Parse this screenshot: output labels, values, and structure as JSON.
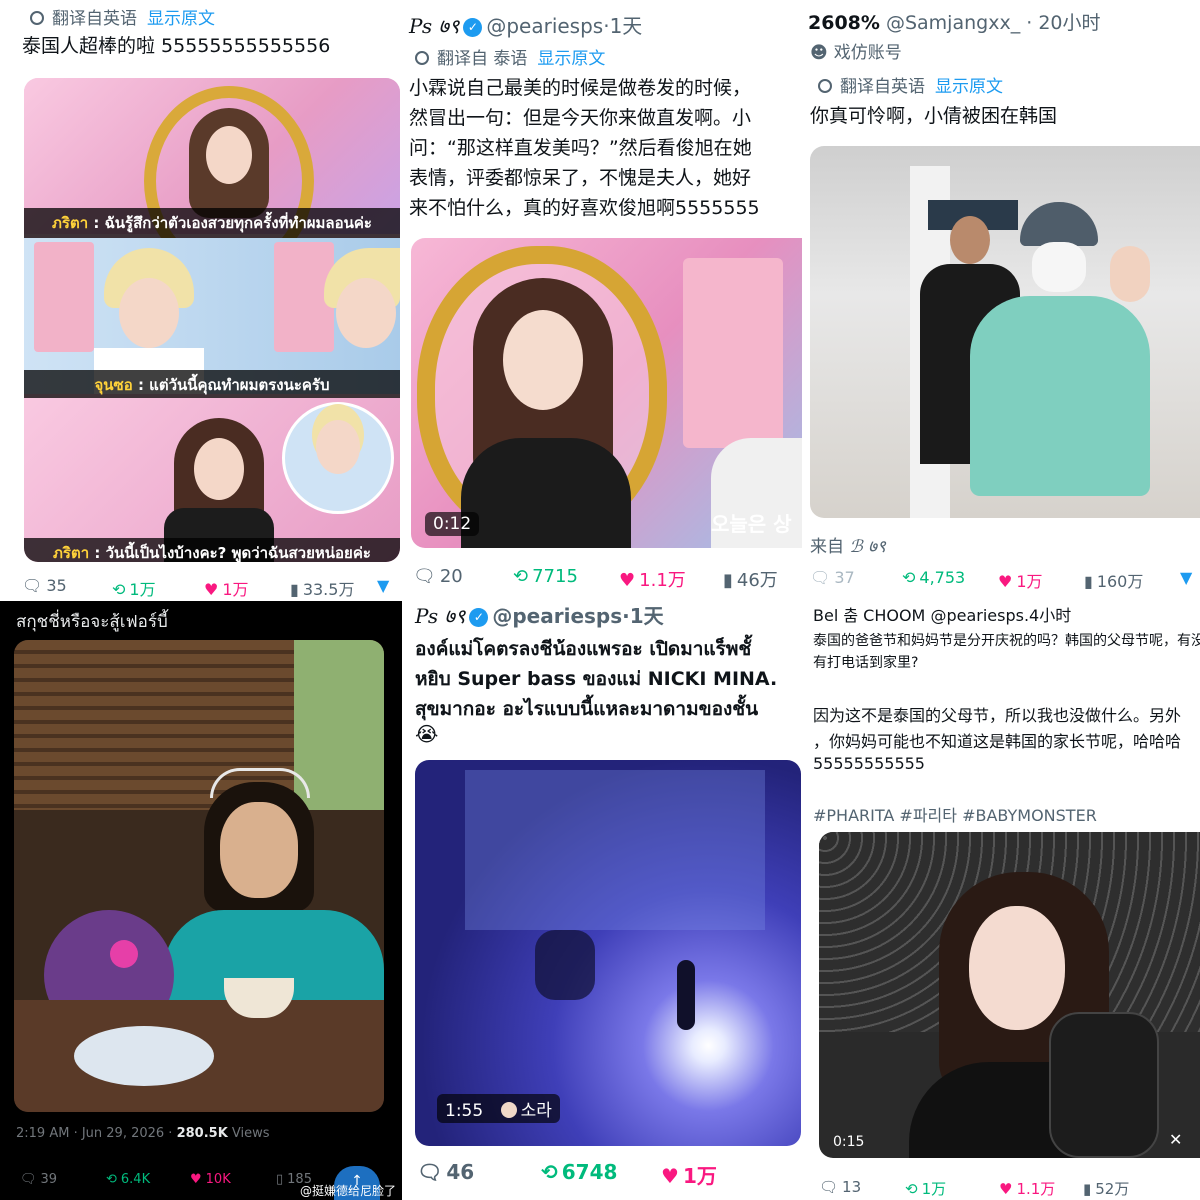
{
  "colors": {
    "accent": "#1d9bf0",
    "retweet": "#00ba7c",
    "like": "#f91880",
    "muted": "#536471"
  },
  "p1": {
    "translated_from": "翻译自英语",
    "show_original": "显示原文",
    "text": "泰国人超棒的啦 55555555555556",
    "sub1_name": "ภริตา",
    "sub1": " : ฉันรู้สึกว่าตัวเองสวยทุกครั้งที่ทำผมลอนค่ะ",
    "sub2_name": "จุนซอ",
    "sub2": " : แต่วันนี้คุณทำผมตรงนะครับ",
    "sub3_name": "ภริตา",
    "sub3": " : วันนี้เป็นไงบ้างคะ? พูดว่าฉันสวยหน่อยค่ะ",
    "replies": "35",
    "retweets": "1万",
    "likes": "1万",
    "views": "33.5万"
  },
  "p2": {
    "name": "Ps ७९",
    "handle": "@peariesps",
    "time": "·1天",
    "translated_from": "翻译自 泰语",
    "show_original": "显示原文",
    "text_lines": [
      "小霖说自己最美的时候是做卷发的时候，",
      "然冒出一句：但是今天你来做直发啊。小",
      "问：“那这样直发美吗？”然后看俊旭在她",
      "表情，评委都惊呆了，不愧是夫人，她好",
      "来不怕什么，真的好喜欢俊旭啊5555555"
    ],
    "duration": "0:12",
    "korean_caption": "오늘은 상",
    "replies": "20",
    "retweets": "7715",
    "likes": "1.1万",
    "views": "46万"
  },
  "p3": {
    "name": "2608%",
    "handle": "@Samjangxx_",
    "time": "· 20小时",
    "parody": "戏仿账号",
    "translated_from": "翻译自英语",
    "show_original": "显示原文",
    "text": "你真可怜啊，小倩被困在韩国",
    "from_label": "来自",
    "from_name": "ℬ ७९",
    "replies": "37",
    "retweets": "4,753",
    "likes": "1万",
    "views": "160万"
  },
  "p4": {
    "text": "สกุชชี่หรือจะสู้เฟอร์บี้",
    "timestamp": "2:19 AM · Jun 29, 2026 · ",
    "views_num": "280.5K",
    "views_label": " Views",
    "replies": "39",
    "retweets": "6.4K",
    "likes": "10K",
    "bookmarks": "185",
    "watermark": "@挺嫌德给尼脸了"
  },
  "p5": {
    "name": "Ps ७९",
    "handle": "@peariesps",
    "time": "·1天",
    "text_lines": [
      "องค์แม่โคตรลงชีน้องแพรอะ เปิดมาแร็พชั้",
      "หยิบ Super bass ของแม่ NICKI MINA.",
      "สุขมากอะ อะไรแบบนี้แหละมาดามของชั้น",
      "😭"
    ],
    "duration": "1:55",
    "sora": "소라",
    "replies": "46",
    "retweets": "6748",
    "likes": "1万"
  },
  "p6": {
    "quote_header": "Bel 춤 CHOOM @peariesps.4小时",
    "q1": "泰国的爸爸节和妈妈节是分开庆祝的吗？韩国的父母节呢，有没",
    "q2": "有打电话到家里?",
    "a1": "因为这不是泰国的父母节，所以我也没做什么。另外",
    "a2": "，你妈妈可能也不知道这是韩国的家长节呢，哈哈哈",
    "a3": "55555555555",
    "hashtags": "#PHARITA #파리타 #BABYMONSTER",
    "duration": "0:15",
    "replies": "13",
    "retweets": "1万",
    "likes": "1.1万",
    "views": "52万"
  }
}
